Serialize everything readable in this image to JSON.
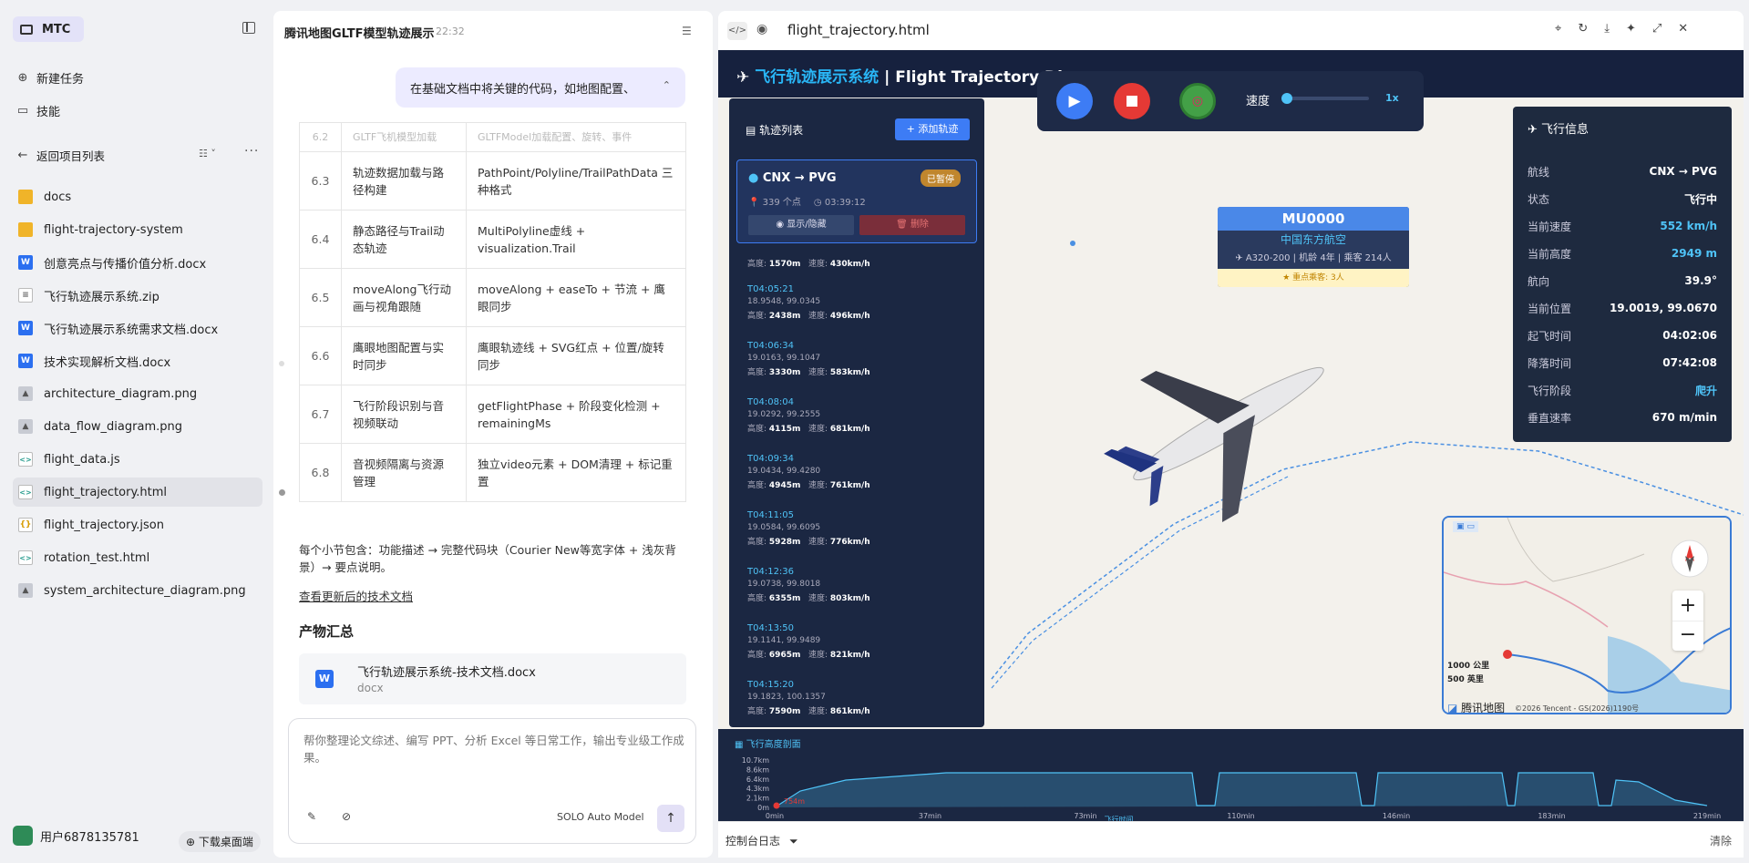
{
  "sidebar": {
    "brand": "MTC",
    "new_task": "新建任务",
    "skills": "技能",
    "back": "返回项目列表",
    "files": [
      {
        "name": "docs",
        "type": "folder"
      },
      {
        "name": "flight-trajectory-system",
        "type": "folder"
      },
      {
        "name": "创意亮点与传播价值分析.docx",
        "type": "docx"
      },
      {
        "name": "飞行轨迹展示系统.zip",
        "type": "zip"
      },
      {
        "name": "飞行轨迹展示系统需求文档.docx",
        "type": "docx"
      },
      {
        "name": "技术实现解析文档.docx",
        "type": "docx"
      },
      {
        "name": "architecture_diagram.png",
        "type": "png"
      },
      {
        "name": "data_flow_diagram.png",
        "type": "png"
      },
      {
        "name": "flight_data.js",
        "type": "code"
      },
      {
        "name": "flight_trajectory.html",
        "type": "code"
      },
      {
        "name": "flight_trajectory.json",
        "type": "json"
      },
      {
        "name": "rotation_test.html",
        "type": "code"
      },
      {
        "name": "system_architecture_diagram.png",
        "type": "png"
      }
    ],
    "user": "用户6878135781",
    "download": "下载桌面端"
  },
  "chat": {
    "title": "腾讯地图GLTF模型轨迹展示",
    "time": "22:32",
    "bubble": "在基础文档中将关键的代码，如地图配置、",
    "table": [
      {
        "n": "6.2",
        "a": "GLTF飞机模型加载",
        "b": "GLTFModel加载配置、旋转、事件"
      },
      {
        "n": "6.3",
        "a": "轨迹数据加载与路径构建",
        "b": "PathPoint/Polyline/TrailPathData 三种格式"
      },
      {
        "n": "6.4",
        "a": "静态路径与Trail动态轨迹",
        "b": "MultiPolyline虚线 + visualization.Trail"
      },
      {
        "n": "6.5",
        "a": "moveAlong飞行动画与视角跟随",
        "b": "moveAlong + easeTo + 节流 + 鹰眼同步"
      },
      {
        "n": "6.6",
        "a": "鹰眼地图配置与实时同步",
        "b": "鹰眼轨迹线 + SVG红点 + 位置/旋转同步"
      },
      {
        "n": "6.7",
        "a": "飞行阶段识别与音视频联动",
        "b": "getFlightPhase + 阶段变化检测 + remainingMs"
      },
      {
        "n": "6.8",
        "a": "音视频隔离与资源管理",
        "b": "独立video元素 + DOM清理 + 标记重置"
      }
    ],
    "note": "每个小节包含：功能描述 → 完整代码块（Courier New等宽字体 + 浅灰背景）→ 要点说明。",
    "link": "查看更新后的技术文档",
    "artifacts_heading": "产物汇总",
    "artifact_name": "飞行轨迹展示系统-技术文档.docx",
    "artifact_ext": "docx",
    "placeholder": "帮你整理论文综述、编写 PPT、分析 Excel 等日常工作，输出专业级工作成果。",
    "model": "SOLO Auto Model"
  },
  "browser": {
    "tab_title": "flight_trajectory.html",
    "app_title_accent": "飞行轨迹展示系统",
    "app_title_rest": " | Flight Trajectory Di",
    "speed_label": "速度",
    "speed_value": "1x",
    "speed_fraction": 0.0,
    "track_list_title": "轨迹列表",
    "add_track": "+ 添加轨迹",
    "route": "CNX → PVG",
    "route_status": "已暂停",
    "route_points": "339 个点",
    "route_duration": "03:39:12",
    "toggle_btn": "显示/隐藏",
    "delete_btn": "删除",
    "first_row": {
      "alt": "1570m",
      "spd": "430km/h"
    },
    "points": [
      {
        "t": "T04:05:21",
        "c": "18.9548, 99.0345",
        "alt": "2438m",
        "spd": "496km/h"
      },
      {
        "t": "T04:06:34",
        "c": "19.0163, 99.1047",
        "alt": "3330m",
        "spd": "583km/h"
      },
      {
        "t": "T04:08:04",
        "c": "19.0292, 99.2555",
        "alt": "4115m",
        "spd": "681km/h"
      },
      {
        "t": "T04:09:34",
        "c": "19.0434, 99.4280",
        "alt": "4945m",
        "spd": "761km/h"
      },
      {
        "t": "T04:11:05",
        "c": "19.0584, 99.6095",
        "alt": "5928m",
        "spd": "776km/h"
      },
      {
        "t": "T04:12:36",
        "c": "19.0738, 99.8018",
        "alt": "6355m",
        "spd": "803km/h"
      },
      {
        "t": "T04:13:50",
        "c": "19.1141, 99.9489",
        "alt": "6965m",
        "spd": "821km/h"
      },
      {
        "t": "T04:15:20",
        "c": "19.1823, 100.1357",
        "alt": "7590m",
        "spd": "861km/h"
      }
    ],
    "alt_label": "高度:",
    "spd_label": "速度:",
    "flight_no": "MU0000",
    "airline": "中国东方航空",
    "aircraft": "A320-200 | 机龄 4年 | 乘客 214人",
    "vip": "重点乘客: 3人",
    "info_title": "飞行信息",
    "info": [
      {
        "k": "航线",
        "v": "CNX → PVG",
        "b": false
      },
      {
        "k": "状态",
        "v": "飞行中",
        "b": false
      },
      {
        "k": "当前速度",
        "v": "552 km/h",
        "b": true
      },
      {
        "k": "当前高度",
        "v": "2949 m",
        "b": true
      },
      {
        "k": "航向",
        "v": "39.9°",
        "b": false
      },
      {
        "k": "当前位置",
        "v": "19.0019, 99.0670",
        "b": false
      },
      {
        "k": "起飞时间",
        "v": "04:02:06",
        "b": false
      },
      {
        "k": "降落时间",
        "v": "07:42:08",
        "b": false
      },
      {
        "k": "飞行阶段",
        "v": "爬升",
        "b": true
      },
      {
        "k": "垂直速率",
        "v": "670 m/min",
        "b": false
      }
    ],
    "minimap_scale_km": "1000 公里",
    "minimap_scale_mi": "500 英里",
    "minimap_logo": "腾讯地图",
    "minimap_copy": "©2026 Tencent - GS(2026)1190号",
    "profile_title": "飞行高度剖面",
    "profile_y": [
      "10.7km",
      "8.6km",
      "6.4km",
      "4.3km",
      "2.1km",
      "0m"
    ],
    "profile_x": [
      "0min",
      "37min",
      "73min",
      "110min",
      "146min",
      "183min",
      "219min"
    ],
    "profile_xlabel": "飞行时间",
    "profile_marker": "754m",
    "console": "控制台日志",
    "clear": "清除"
  }
}
